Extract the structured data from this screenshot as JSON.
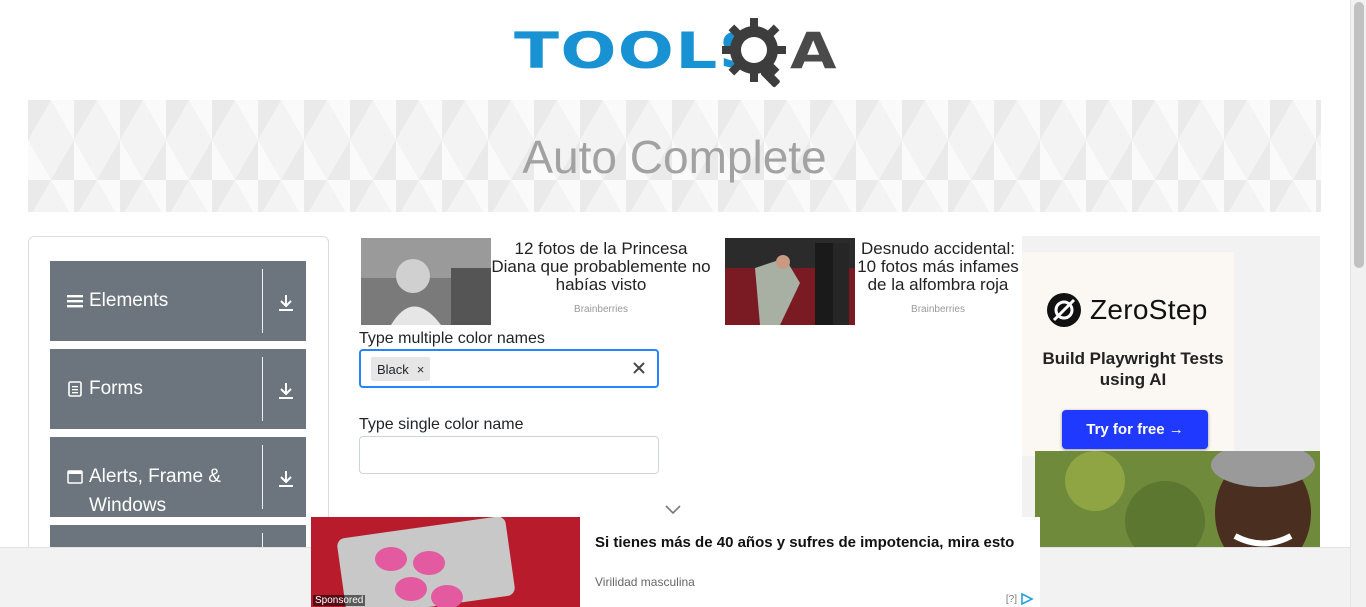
{
  "logo": {
    "word": "TOOLS",
    "q_icon": "gear-magnifier-icon",
    "a": "A"
  },
  "page_title": "Auto Complete",
  "sidebar": {
    "groups": [
      {
        "label": "Elements",
        "icon": "hamburger-icon"
      },
      {
        "label": "Forms",
        "icon": "document-icon"
      },
      {
        "label": "Alerts, Frame & Windows",
        "icon": "window-icon"
      },
      {
        "label": "",
        "icon": ""
      }
    ]
  },
  "ads": [
    {
      "title": "12 fotos de la Princesa Diana que probablemente no habías visto",
      "source": "Brainberries"
    },
    {
      "title": "Desnudo accidental: 10 fotos más infames de la alfombra roja",
      "source": "Brainberries"
    }
  ],
  "form": {
    "multi_label": "Type multiple color names",
    "multi_values": [
      "Black"
    ],
    "chip_remove": "×",
    "single_label": "Type single color name",
    "single_value": ""
  },
  "right_ad": {
    "brand": "ZeroStep",
    "tagline": "Build Playwright Tests using AI",
    "cta": "Try for free →"
  },
  "bottom_ad": {
    "title": "Si tienes más de 40 años y sufres de impotencia, mira esto",
    "source": "Virilidad masculina",
    "sponsored": "Sponsored",
    "info": "[?]"
  },
  "colors": {
    "brand_blue": "#1992d4",
    "sidebar_gray": "#6c757d",
    "focus_blue": "#2684ff",
    "cta_blue": "#1f39ff"
  }
}
